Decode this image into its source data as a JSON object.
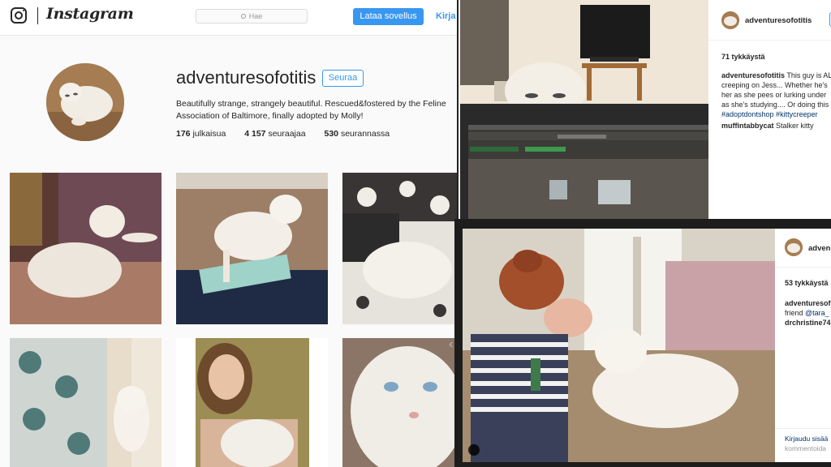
{
  "topbar": {
    "logo_text": "Instagram",
    "search_placeholder": "Hae",
    "download_label": "Lataa sovellus",
    "login_label": "Kirja"
  },
  "profile": {
    "username": "adventuresofotitis",
    "follow_label": "Seuraa",
    "bio_line1": "Beautifully strange, strangely beautiful. Rescued&fostered by the Feline",
    "bio_line2": "Association of Baltimore, finally adopted by Molly!",
    "stats": [
      {
        "count": "176",
        "label": "julkaisua"
      },
      {
        "count": "4 157",
        "label": "seuraajaa"
      },
      {
        "count": "530",
        "label": "seurannassa"
      }
    ]
  },
  "grid_posts": [
    {
      "alt": "white cat lying on a brown couch"
    },
    {
      "alt": "white cat standing on a laptop"
    },
    {
      "alt": "white cat lying on patterned cushions"
    },
    {
      "alt": "white cat behind a shower curtain"
    },
    {
      "alt": "woman holding a white cat"
    },
    {
      "alt": "close-up of a white cat face"
    }
  ],
  "post1": {
    "username": "adventuresofotitis",
    "likes": "71 tykkäystä",
    "caption_user": "adventuresofotitis",
    "caption_lines": [
      "This guy is AL",
      "creeping on Jess... Whether he's",
      "her as she pees or lurking under",
      "as she's studying.... Or doing this"
    ],
    "hashtags": "#adoptdontshop #kittycreeper",
    "comment_user": "muffintabbycat",
    "comment_text": "Stalker kitty"
  },
  "post2": {
    "username": "adven",
    "likes": "53 tykkäystä",
    "caption_user": "adventuresof",
    "caption_line2_prefix": "friend ",
    "mention": "@tara_",
    "comment_user": "drchristine74",
    "footer_login": "Kirjaudu sisää",
    "footer_comment": "kommentoida"
  },
  "colors": {
    "accent": "#3897f0",
    "text": "#262626",
    "page_bg": "#fafafa"
  }
}
